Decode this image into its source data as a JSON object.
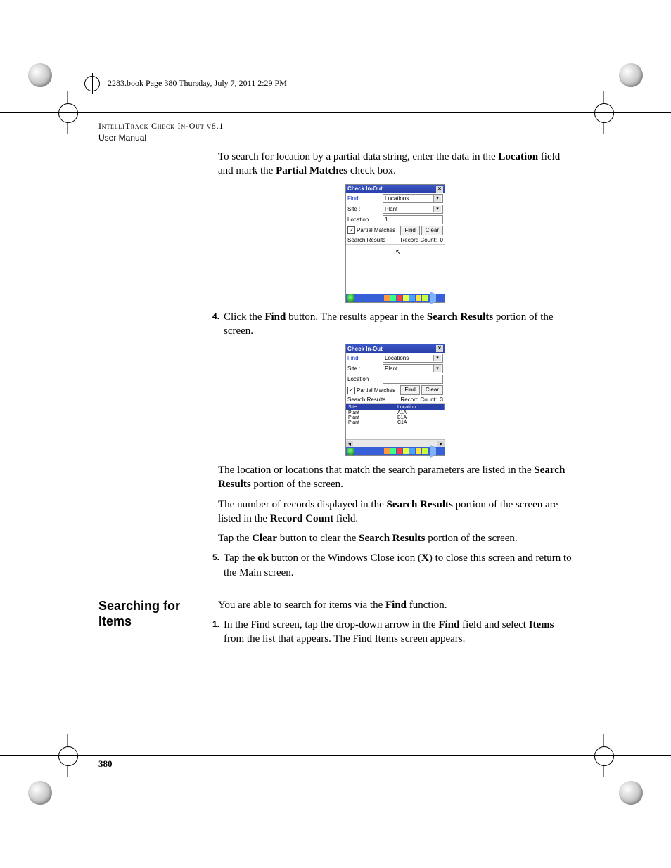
{
  "running_header": "2283.book  Page 380  Thursday, July 7, 2011  2:29 PM",
  "doc": {
    "title_caps": "IntelliTrack Check In-Out v8.1",
    "subtitle": "User Manual"
  },
  "intro_para_pre": "To search for location by a partial data string, enter the data in the ",
  "intro_b1": "Location",
  "intro_mid1": " field and mark the ",
  "intro_b2": "Partial Matches",
  "intro_post": " check box.",
  "pda1": {
    "title": "Check In-Out",
    "find_label": "Find",
    "find_value": "Locations",
    "site_label": "Site :",
    "site_value": "Plant",
    "location_label": "Location :",
    "location_value": "1",
    "partial_label": "Partial Matches",
    "partial_checked": "✓",
    "find_btn": "Find",
    "clear_btn": "Clear",
    "search_results_label": "Search Results",
    "record_count_label": "Record Count:",
    "record_count_value": "0"
  },
  "step4": {
    "num": "4.",
    "pre": "Click the ",
    "b1": "Find",
    "mid": " button. The results appear in the ",
    "b2": "Search Results",
    "post": " portion of the screen."
  },
  "pda2": {
    "title": "Check In-Out",
    "find_label": "Find",
    "find_value": "Locations",
    "site_label": "Site :",
    "site_value": "Plant",
    "location_label": "Location :",
    "location_value": "",
    "partial_label": "Partial Matches",
    "partial_checked": "✓",
    "find_btn": "Find",
    "clear_btn": "Clear",
    "search_results_label": "Search Results",
    "record_count_label": "Record Count:",
    "record_count_value": "3",
    "col_site": "Site",
    "col_location": "Location",
    "rows": [
      {
        "site": "Plant",
        "location": "A1A"
      },
      {
        "site": "Plant",
        "location": "B1A"
      },
      {
        "site": "Plant",
        "location": "C1A"
      }
    ]
  },
  "para_match": {
    "pre": "The location or locations that match the search parameters are listed in the ",
    "b1": "Search Results",
    "post": " portion of the screen."
  },
  "para_count": {
    "pre": "The number of records displayed in the ",
    "b1": "Search Results",
    "mid": " portion of the screen are listed in the ",
    "b2": "Record Count",
    "post": " field."
  },
  "para_clear": {
    "pre": "Tap the ",
    "b1": "Clear",
    "mid": " button to clear the ",
    "b2": "Search Results",
    "post": " portion of the screen."
  },
  "step5": {
    "num": "5.",
    "pre": "Tap the ",
    "b1": "ok",
    "mid": " button or the Windows Close icon (",
    "b2": "X",
    "post": ") to close this screen and return to the Main screen."
  },
  "section": {
    "title_line1": "Searching for",
    "title_line2": "Items",
    "intro_pre": "You are able to search for items via the ",
    "intro_b": "Find",
    "intro_post": " function."
  },
  "sec_step1": {
    "num": "1.",
    "pre": "In the Find screen, tap the drop-down arrow in the ",
    "b1": "Find",
    "mid": " field and select ",
    "b2": "Items",
    "post": " from the list that appears. The Find Items screen appears."
  },
  "page_number": "380"
}
